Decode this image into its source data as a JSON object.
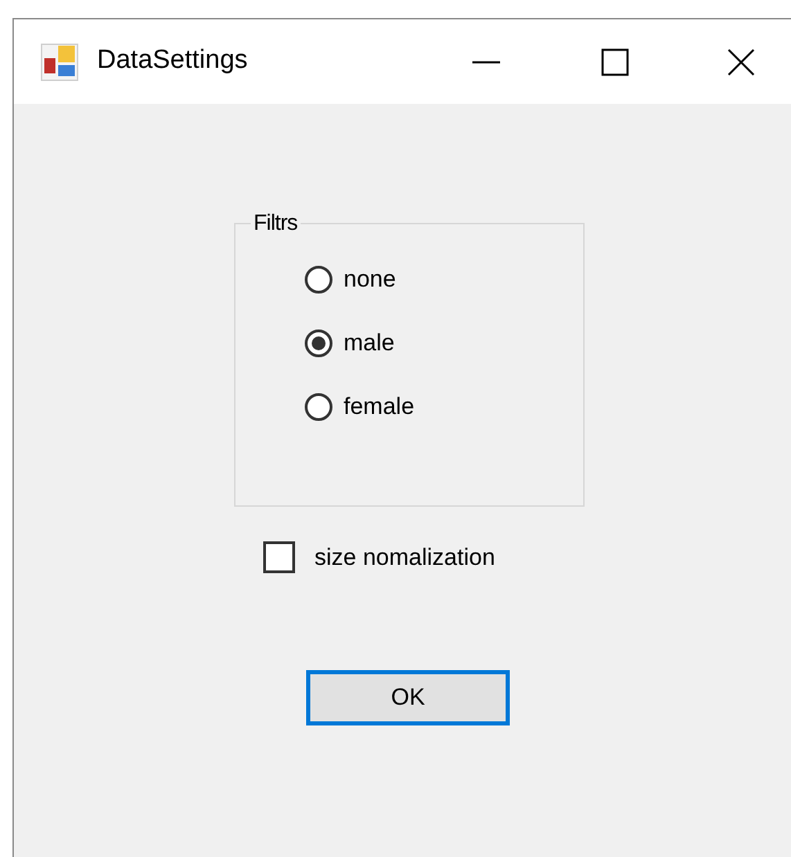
{
  "window": {
    "title": "DataSettings"
  },
  "filter_group": {
    "title": "Filtrs",
    "options": [
      {
        "label": "none",
        "selected": false
      },
      {
        "label": "male",
        "selected": true
      },
      {
        "label": "female",
        "selected": false
      }
    ]
  },
  "size_normalization": {
    "label": "size nomalization",
    "checked": false
  },
  "buttons": [
    {
      "label": "OK",
      "focused": true
    }
  ]
}
